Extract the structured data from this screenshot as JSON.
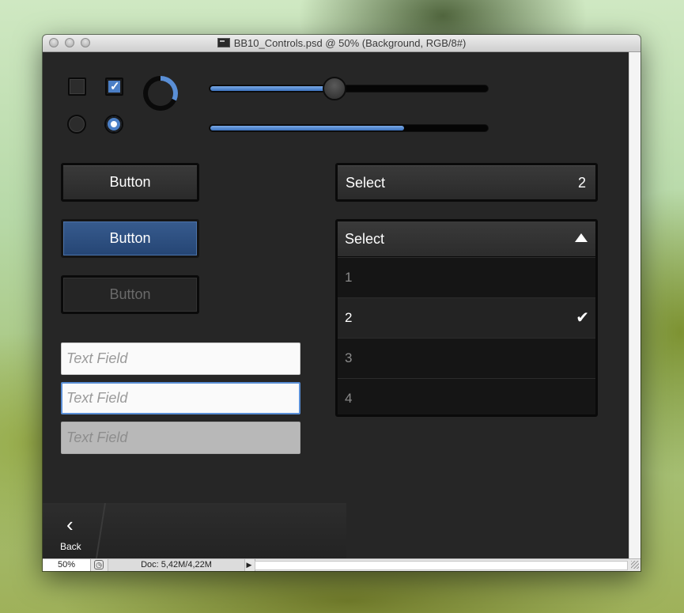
{
  "window": {
    "title": "BB10_Controls.psd @ 50% (Background, RGB/8#)",
    "traffic_lights": [
      "close-icon",
      "minimize-icon",
      "zoom-icon"
    ]
  },
  "controls": {
    "checkbox_unchecked": {
      "checked": false
    },
    "checkbox_checked": {
      "checked": true,
      "icon": "checkmark-icon"
    },
    "radio_unchecked": {
      "selected": false
    },
    "radio_selected": {
      "selected": true
    },
    "activity_indicator": {
      "icon": "spinner-icon"
    },
    "slider": {
      "value": 0.45
    },
    "progress": {
      "value": 0.7
    }
  },
  "buttons": {
    "normal": "Button",
    "active": "Button",
    "disabled": "Button"
  },
  "text_fields": {
    "normal_placeholder": "Text Field",
    "focused_placeholder": "Text Field",
    "disabled_placeholder": "Text Field"
  },
  "select_collapsed": {
    "label": "Select",
    "value": "2"
  },
  "select_expanded": {
    "label": "Select",
    "icon": "triangle-up-icon",
    "options": [
      "1",
      "2",
      "3",
      "4"
    ],
    "selected_index": 1,
    "selected_icon": "checkmark-icon"
  },
  "action_bar": {
    "back_label": "Back",
    "back_icon": "chevron-left-icon"
  },
  "status_bar": {
    "zoom": "50%",
    "doc_info": "Doc: 5,42M/4,22M"
  },
  "colors": {
    "accent": "#4b7fc6",
    "background": "#262626"
  }
}
